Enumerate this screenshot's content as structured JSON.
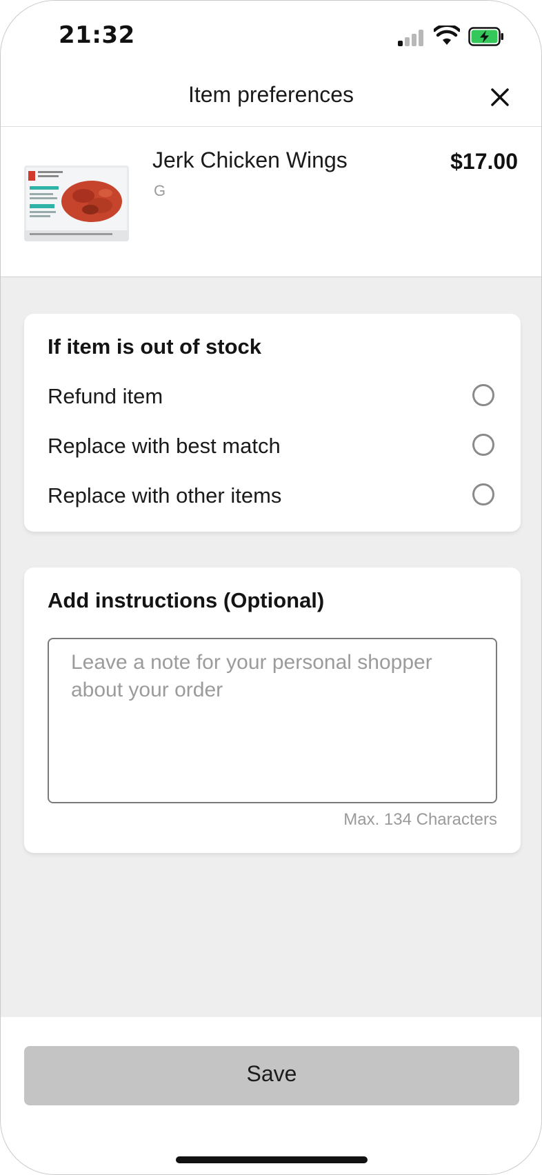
{
  "status_bar": {
    "time": "21:32",
    "icons": [
      "signal-icon",
      "wifi-icon",
      "battery-charging-icon"
    ],
    "battery_color": "#34c759"
  },
  "header": {
    "title": "Item preferences",
    "close_icon": "close-icon"
  },
  "product": {
    "name": "Jerk Chicken Wings",
    "unit": "G",
    "price": "$17.00",
    "image_icon": "product-package-image"
  },
  "out_of_stock": {
    "heading": "If item is out of stock",
    "options": [
      {
        "label": "Refund item",
        "selected": false
      },
      {
        "label": "Replace with best match",
        "selected": false
      },
      {
        "label": "Replace with other items",
        "selected": false
      }
    ]
  },
  "instructions": {
    "heading": "Add instructions (Optional)",
    "placeholder": "Leave a note for your personal shopper about your order",
    "value": "",
    "limit_text": "Max. 134 Characters"
  },
  "footer": {
    "save_label": "Save",
    "save_color": "#c4c4c4"
  },
  "colors": {
    "background": "#eeeeee",
    "card": "#ffffff",
    "text": "#1a1a1a",
    "muted": "#9a9a9a"
  }
}
